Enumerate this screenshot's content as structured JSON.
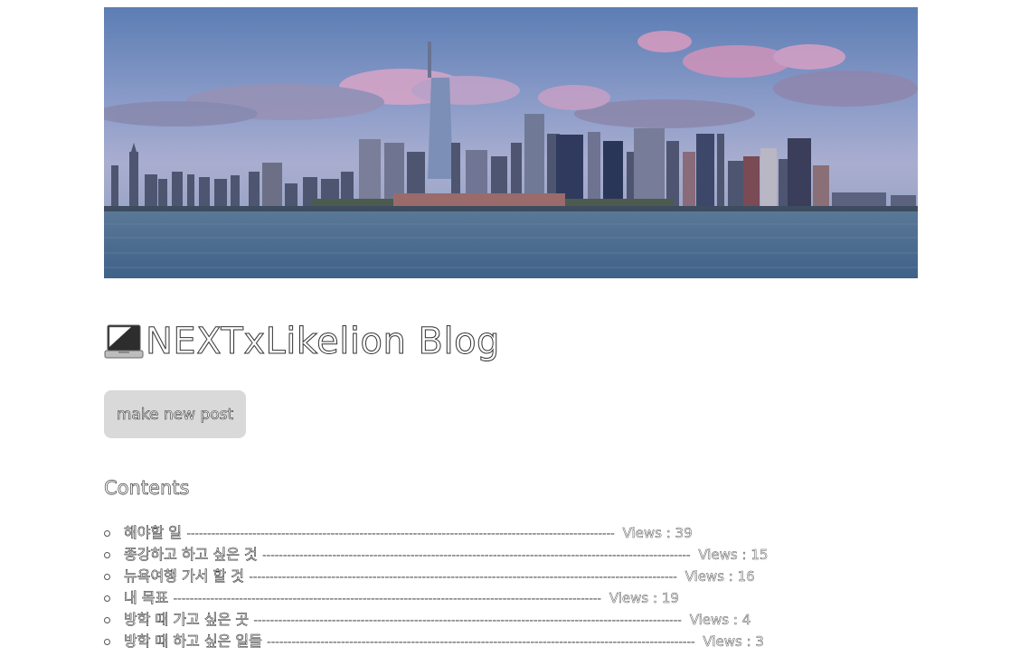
{
  "banner": {
    "alt": "New York skyline at dusk",
    "colors": {
      "sky_top": "#5f7fb3",
      "sky_mid": "#8c9bc6",
      "cloud_pink": "#d9a3c4",
      "water": "#4e6f93"
    }
  },
  "header": {
    "title": "NEXTxLikelion Blog",
    "icon": "laptop-icon"
  },
  "actions": {
    "new_post_label": "make new post"
  },
  "contents": {
    "heading": "Contents",
    "posts": [
      {
        "title": "해야할 일",
        "dashes": "--------------------------------------------------------------------------------------------------------",
        "views_text": "Views : 39"
      },
      {
        "title": "종강하고 하고 싶은 것",
        "dashes": "--------------------------------------------------------------------------------------------------------",
        "views_text": "Views : 15"
      },
      {
        "title": "뉴욕여행 가서 할 것",
        "dashes": "--------------------------------------------------------------------------------------------------------",
        "views_text": "Views : 16"
      },
      {
        "title": "내 목표",
        "dashes": "--------------------------------------------------------------------------------------------------------",
        "views_text": "Views : 19"
      },
      {
        "title": "방학 때 가고 싶은 곳",
        "dashes": "--------------------------------------------------------------------------------------------------------",
        "views_text": "Views : 4"
      },
      {
        "title": "방학 때 하고 싶은 일들",
        "dashes": "--------------------------------------------------------------------------------------------------------",
        "views_text": "Views : 3"
      }
    ]
  }
}
